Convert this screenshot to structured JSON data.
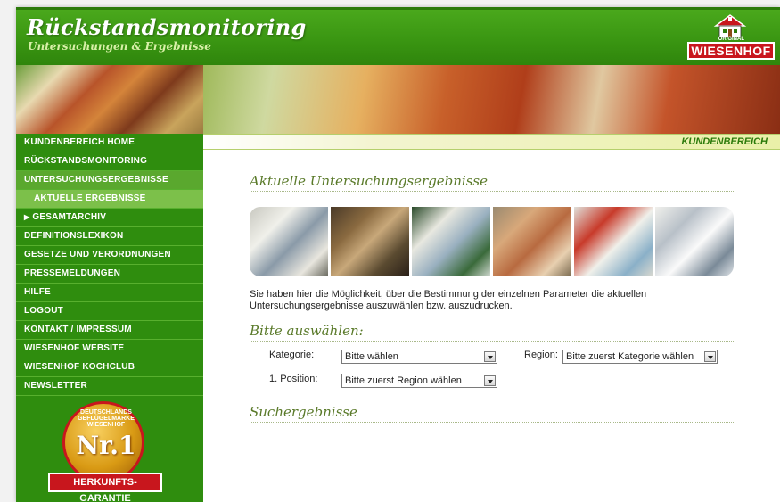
{
  "header": {
    "title": "Rückstandsmonitoring",
    "subtitle": "Untersuchungen & Ergebnisse",
    "logo_text": "WIESENHOF",
    "logo_small": "ORIGINAL"
  },
  "sidebar": {
    "items": [
      {
        "label": "KUNDENBEREICH HOME"
      },
      {
        "label": "RÜCKSTANDSMONITORING"
      },
      {
        "label": "UNTERSUCHUNGSERGEBNISSE"
      },
      {
        "label": "AKTUELLE ERGEBNISSE"
      },
      {
        "label": "GESAMTARCHIV"
      },
      {
        "label": "DEFINITIONSLEXIKON"
      },
      {
        "label": "GESETZE UND VERORDNUNGEN"
      },
      {
        "label": "PRESSEMELDUNGEN"
      },
      {
        "label": "HILFE"
      },
      {
        "label": "LOGOUT"
      },
      {
        "label": "KONTAKT / IMPRESSUM"
      },
      {
        "label": "WIESENHOF WEBSITE"
      },
      {
        "label": "WIESENHOF KOCHCLUB"
      },
      {
        "label": "NEWSLETTER"
      }
    ],
    "badge": {
      "ring_text": "DEUTSCHLANDS GEFLÜGELMARKE",
      "brand": "WIESENHOF",
      "number": "Nr.1",
      "bar_text": "HERKUNFTS-GARANTIE"
    }
  },
  "main": {
    "section_label": "KUNDENBEREICH",
    "heading": "Aktuelle Untersuchungsergebnisse",
    "intro": "Sie haben hier die Möglichkeit, über die Bestimmung der einzelnen Parameter die aktuellen Untersuchungsergebnisse auszuwählen bzw. auszudrucken.",
    "select_heading": "Bitte auswählen:",
    "kategorie_label": "Kategorie:",
    "kategorie_value": "Bitte wählen",
    "region_label": "Region:",
    "region_value": "Bitte zuerst Kategorie wählen",
    "position_label": "1. Position:",
    "position_value": "Bitte zuerst Region wählen",
    "results_heading": "Suchergebnisse"
  },
  "colors": {
    "brand_green": "#3a9612",
    "nav_green": "#2f8d0e",
    "active_green": "#5aa82e",
    "logo_red": "#c8161d"
  }
}
